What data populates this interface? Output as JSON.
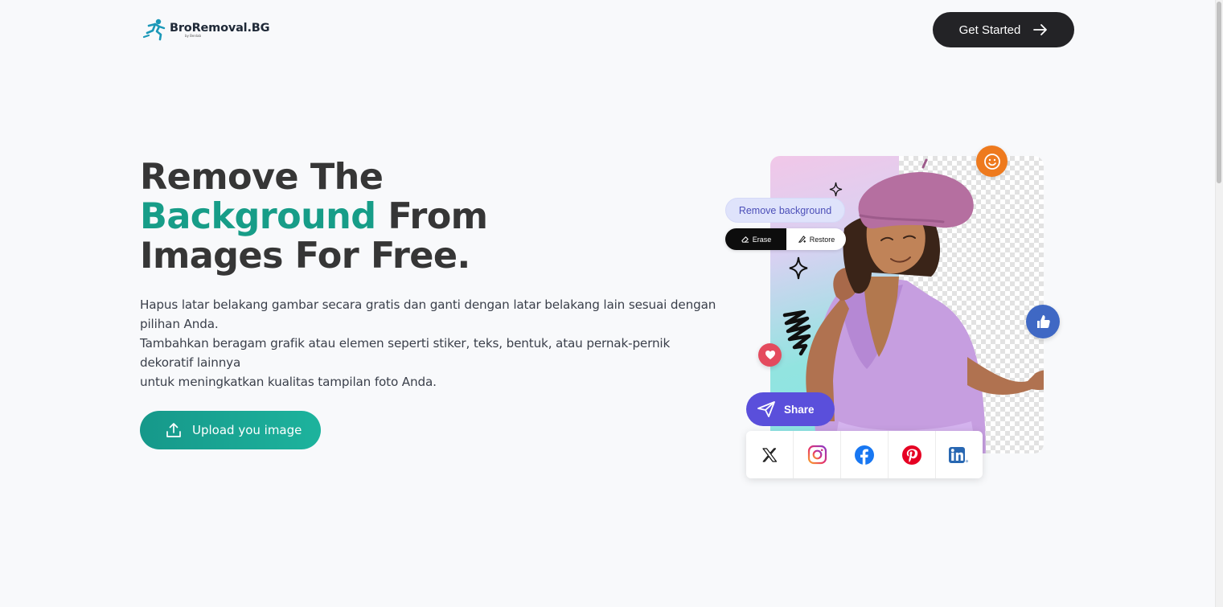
{
  "header": {
    "logo_text": "BroRemoval.BG",
    "logo_subtext": "by Benlab",
    "cta_label": "Get Started"
  },
  "hero": {
    "title_line1": "Remove The",
    "title_accent": "Background",
    "title_line2_rest": " From",
    "title_line3": "Images For Free.",
    "description_line1": "Hapus latar belakang gambar secara gratis dan ganti dengan latar belakang lain sesuai dengan pilihan Anda.",
    "description_line2": "Tambahkan beragam grafik atau elemen seperti stiker, teks, bentuk, atau pernak-pernik dekoratif lainnya",
    "description_line3": "untuk meningkatkan kualitas tampilan foto Anda.",
    "upload_label": "Upload you image"
  },
  "illustration": {
    "remove_bg_label": "Remove background",
    "erase_label": "Erase",
    "restore_label": "Restore",
    "share_label": "Share",
    "social_icons": [
      "x-icon",
      "instagram-icon",
      "facebook-icon",
      "pinterest-icon",
      "linkedin-icon"
    ]
  },
  "colors": {
    "accent": "#179d88",
    "cta_bg": "#232326",
    "share_bg": "#5a4fdb",
    "page_bg": "#f8f9fb"
  }
}
